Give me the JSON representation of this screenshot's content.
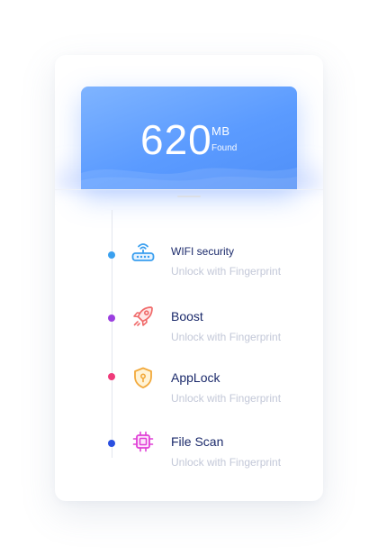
{
  "summary": {
    "amount": "620",
    "unit": "MB",
    "caption": "Found"
  },
  "colors": {
    "accent": "#5b9bff",
    "title_text": "#1b2a6b",
    "subtitle_text": "#c3c8d8"
  },
  "items": [
    {
      "title": "WIFI security",
      "subtitle": "Unlock with Fingerprint",
      "icon": "router-icon",
      "dot_color": "#3aa0ef"
    },
    {
      "title": "Boost",
      "subtitle": "Unlock with Fingerprint",
      "icon": "rocket-icon",
      "dot_color": "#9b3fe0"
    },
    {
      "title": "AppLock",
      "subtitle": "Unlock with Fingerprint",
      "icon": "shield-lock-icon",
      "dot_color": "#ef3a7a"
    },
    {
      "title": "File Scan",
      "subtitle": "Unlock with Fingerprint",
      "icon": "chip-icon",
      "dot_color": "#2a4fe0"
    }
  ]
}
